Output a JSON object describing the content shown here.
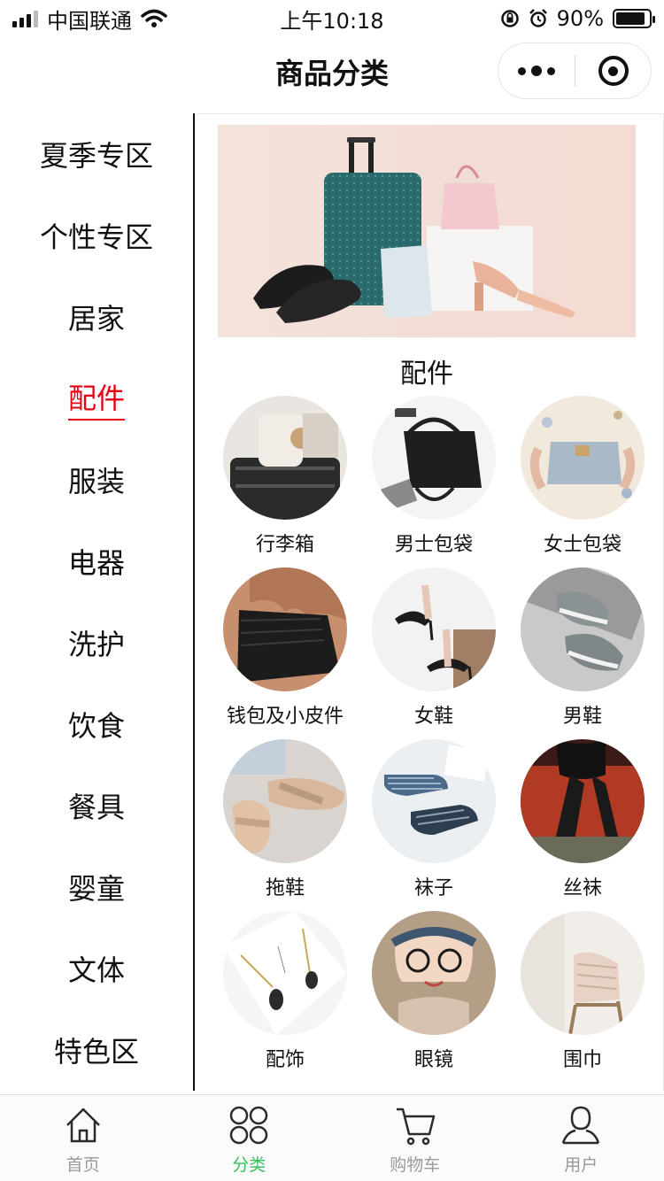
{
  "status_bar": {
    "carrier": "中国联通",
    "time": "上午10:18",
    "battery_percent": "90%",
    "battery_level": 0.9
  },
  "nav": {
    "title": "商品分类"
  },
  "sidebar": {
    "active_color": "#e60012",
    "items": [
      {
        "label": "夏季专区"
      },
      {
        "label": "个性专区"
      },
      {
        "label": "居家"
      },
      {
        "label": "配件",
        "active": true
      },
      {
        "label": "服装"
      },
      {
        "label": "电器"
      },
      {
        "label": "洗护"
      },
      {
        "label": "饮食"
      },
      {
        "label": "餐具"
      },
      {
        "label": "婴童"
      },
      {
        "label": "文体"
      },
      {
        "label": "特色区"
      }
    ]
  },
  "main": {
    "section_title": "配件",
    "categories": [
      {
        "label": "行李箱",
        "icon": "luggage-photo"
      },
      {
        "label": "男士包袋",
        "icon": "mens-bag-photo"
      },
      {
        "label": "女士包袋",
        "icon": "womens-bag-photo"
      },
      {
        "label": "钱包及小皮件",
        "icon": "wallet-photo"
      },
      {
        "label": "女鞋",
        "icon": "womens-shoes-photo"
      },
      {
        "label": "男鞋",
        "icon": "mens-shoes-photo"
      },
      {
        "label": "拖鞋",
        "icon": "slippers-photo"
      },
      {
        "label": "袜子",
        "icon": "socks-photo"
      },
      {
        "label": "丝袜",
        "icon": "stockings-photo"
      },
      {
        "label": "配饰",
        "icon": "accessory-photo"
      },
      {
        "label": "眼镜",
        "icon": "glasses-photo"
      },
      {
        "label": "围巾",
        "icon": "scarf-photo"
      }
    ]
  },
  "tab_bar": {
    "active_color": "#35c05a",
    "items": [
      {
        "label": "首页",
        "icon": "home-icon"
      },
      {
        "label": "分类",
        "icon": "category-icon",
        "active": true
      },
      {
        "label": "购物车",
        "icon": "cart-icon"
      },
      {
        "label": "用户",
        "icon": "user-icon"
      }
    ]
  }
}
